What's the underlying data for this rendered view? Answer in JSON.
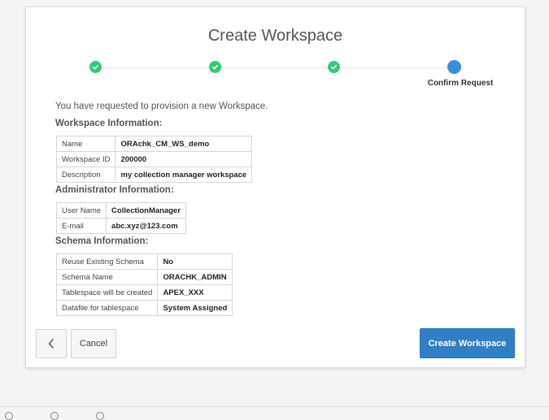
{
  "dialog": {
    "title": "Create Workspace",
    "current_step_label": "Confirm Request",
    "intro": "You have requested to provision a new Workspace."
  },
  "workspace": {
    "heading": "Workspace Information:",
    "rows": [
      {
        "label": "Name",
        "value": "ORAchk_CM_WS_demo"
      },
      {
        "label": "Workspace ID",
        "value": "200000"
      },
      {
        "label": "Description",
        "value": "my collection manager workspace"
      }
    ]
  },
  "administrator": {
    "heading": "Administrator Information:",
    "rows": [
      {
        "label": "User Name",
        "value": "CollectionManager"
      },
      {
        "label": "E-mail",
        "value": "abc.xyz@123.com"
      }
    ]
  },
  "schema": {
    "heading": "Schema Information:",
    "rows": [
      {
        "label": "Reuse Existing Schema",
        "value": "No"
      },
      {
        "label": "Schema Name",
        "value": "ORACHK_ADMIN"
      },
      {
        "label": "Tablespace will be created",
        "value": "APEX_XXX"
      },
      {
        "label": "Datafile for tablespace",
        "value": "System Assigned"
      }
    ]
  },
  "buttons": {
    "cancel": "Cancel",
    "create": "Create Workspace"
  },
  "colors": {
    "step_complete": "#2ecc71",
    "step_current": "#3a8edb",
    "primary_button": "#2f7fc7"
  },
  "icons": {
    "back": "chevron-left-icon",
    "step_done": "check-icon"
  }
}
